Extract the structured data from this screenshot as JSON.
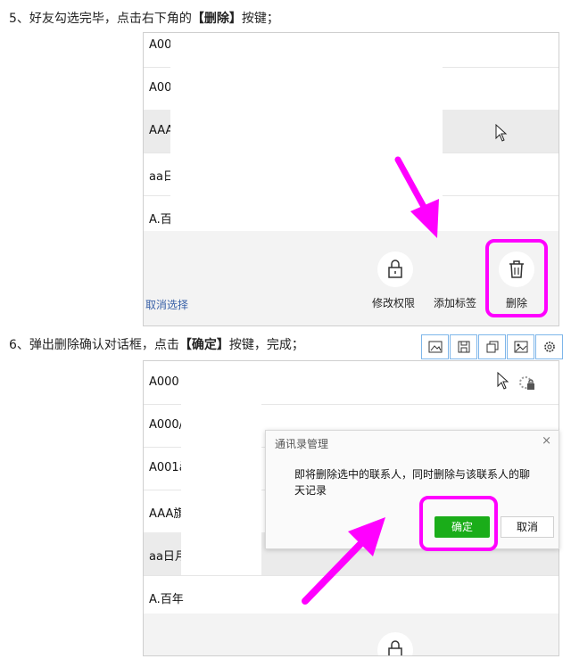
{
  "step5": {
    "num": "5、",
    "pre": "好友勾选完毕，点击右下角的",
    "strong": "【删除】",
    "post": "按键；"
  },
  "step6": {
    "num": "6、",
    "pre": "弹出删除确认对话框，点击",
    "strong": "【确定】",
    "post": "按键，完成；"
  },
  "shot1": {
    "rows": [
      "A00",
      "A00",
      "AAA",
      "aa日",
      "A.百"
    ],
    "selected_index": 2,
    "cancel_select": "取消选择",
    "actions": {
      "permissions": "修改权限",
      "add_tag": "添加标签",
      "delete": "删除"
    }
  },
  "shot2": {
    "rows": [
      "A000",
      "A000/",
      "A001å",
      "AAA旗",
      "aa日月",
      "A.百年"
    ],
    "selected_index": 4,
    "dialog": {
      "title": "通讯录管理",
      "close": "×",
      "message": "即将删除选中的联系人，同时删除与该联系人的聊天记录",
      "confirm": "确定",
      "cancel": "取消"
    }
  },
  "colors": {
    "highlight": "#ff00ff",
    "confirm_green": "#1aad19",
    "link_blue": "#3a62a8"
  }
}
